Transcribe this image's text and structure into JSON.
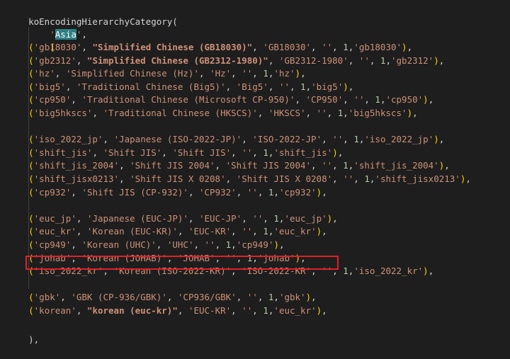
{
  "code": {
    "header": "koEncodingHierarchyCategory(",
    "asia_label": "Asia",
    "asia_comma": ",",
    "open_bracket": "[",
    "groups": [
      [
        {
          "cols": [
            "gb18030",
            "Simplified Chinese (GB18030)",
            "GB18030",
            "",
            "1",
            "gb18030"
          ],
          "bold": true
        },
        {
          "cols": [
            "gb2312",
            "Simplified Chinese (GB2312-1980)",
            "GB2312-1980",
            "",
            "1",
            "gb2312"
          ],
          "bold": true
        },
        {
          "cols": [
            "hz",
            "Simplified Chinese (Hz)",
            "Hz",
            "",
            "1",
            "hz"
          ],
          "bold": false
        },
        {
          "cols": [
            "big5",
            "Traditional Chinese (Big5)",
            "Big5",
            "",
            "1",
            "big5"
          ],
          "bold": false
        },
        {
          "cols": [
            "cp950",
            "Traditional Chinese (Microsoft CP-950)",
            "CP950",
            "",
            "1",
            "cp950"
          ],
          "bold": false
        },
        {
          "cols": [
            "big5hkscs",
            "Traditional Chinese (HKSCS)",
            "HKSCS",
            "",
            "1",
            "big5hkscs"
          ],
          "bold": false
        }
      ],
      [
        {
          "cols": [
            "iso_2022_jp",
            "Japanese (ISO-2022-JP)",
            "ISO-2022-JP",
            "",
            "1",
            "iso_2022_jp"
          ],
          "bold": false
        },
        {
          "cols": [
            "shift_jis",
            "Shift JIS",
            "Shift JIS",
            "",
            "1",
            "shift_jis"
          ],
          "bold": false
        },
        {
          "cols": [
            "shift_jis_2004",
            "Shift JIS 2004",
            "Shift JIS 2004",
            "",
            "1",
            "shift_jis_2004"
          ],
          "bold": false
        },
        {
          "cols": [
            "shift_jisx0213",
            "Shift JIS X 0208",
            "Shift JIS X 0208",
            "",
            "1",
            "shift_jisx0213"
          ],
          "bold": false
        },
        {
          "cols": [
            "cp932",
            "Shift JIS (CP-932)",
            "CP932",
            "",
            "1",
            "cp932"
          ],
          "bold": false
        }
      ],
      [
        {
          "cols": [
            "euc_jp",
            "Japanese (EUC-JP)",
            "EUC-JP",
            "",
            "1",
            "euc_jp"
          ],
          "bold": false
        },
        {
          "cols": [
            "euc_kr",
            "Korean (EUC-KR)",
            "EUC-KR",
            "",
            "1",
            "euc_kr"
          ],
          "bold": false
        },
        {
          "cols": [
            "cp949",
            "Korean (UHC)",
            "UHC",
            "",
            "1",
            "cp949"
          ],
          "bold": false
        },
        {
          "cols": [
            "johab",
            "Korean (JOHAB)",
            "JOHAB",
            "",
            "1",
            "johab"
          ],
          "bold": false
        },
        {
          "cols": [
            "iso_2022_kr",
            "Korean (ISO-2022-KR)",
            "ISO-2022-KR",
            "",
            "1",
            "iso_2022_kr"
          ],
          "bold": false
        }
      ],
      [
        {
          "cols": [
            "gbk",
            "GBK (CP-936/GBK)",
            "CP936/GBK",
            "",
            "1",
            "gbk"
          ],
          "bold": false
        },
        {
          "cols": [
            "korean",
            "korean (euc-kr)",
            "EUC-KR",
            "",
            "1",
            "euc_kr"
          ],
          "bold": false,
          "bold_col": 1,
          "highlighted": true
        }
      ]
    ],
    "closing": "),"
  },
  "colors": {
    "background": "#1e1e1e",
    "string": "#ce9178",
    "number": "#b5cea8",
    "punctuation": "#ffd700",
    "selection": "#2f7f84",
    "annotation_box": "#e0202a"
  }
}
